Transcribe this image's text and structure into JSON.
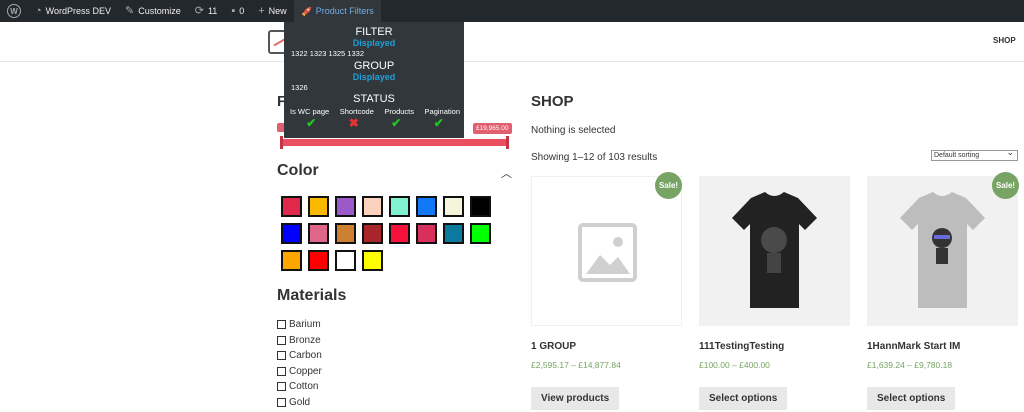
{
  "adminbar": {
    "site_name": "WordPress DEV",
    "customize": "Customize",
    "updates_count": "11",
    "comments_count": "0",
    "new_label": "New",
    "plugin_label": "Product Filters"
  },
  "header": {
    "nav_shop": "SHOP"
  },
  "debug": {
    "filter_heading": "FILTER",
    "filter_state": "Displayed",
    "filter_ids": "1322 1323 1325 1332",
    "group_heading": "GROUP",
    "group_state": "Displayed",
    "group_ids": "1326",
    "status_heading": "STATUS",
    "columns": [
      "Is WC page",
      "Shortcode",
      "Products",
      "Pagination"
    ],
    "statuses": [
      "ok",
      "fail",
      "ok",
      "ok"
    ]
  },
  "sidebar": {
    "filter_title": "F",
    "price_max_label": "£19,965.00",
    "color_title": "Color",
    "colors": [
      "#e0294a",
      "#fbb800",
      "#9b59c9",
      "#fcd1bd",
      "#7ff3cf",
      "#1278f6",
      "#f5f5dc",
      "#000000",
      "#0000ff",
      "#e0678a",
      "#cd7f32",
      "#a8262b",
      "#f7113c",
      "#d92f5c",
      "#0c7a9e",
      "#00ff00",
      "#ffa500",
      "#ff0000",
      "#ffffff",
      "#ffff00"
    ],
    "materials_title": "Materials",
    "materials": [
      "Barium",
      "Bronze",
      "Carbon",
      "Copper",
      "Cotton",
      "Gold"
    ]
  },
  "main": {
    "title": "SHOP",
    "nothing_selected": "Nothing is selected",
    "showing": "Showing 1–12 of 103 results",
    "sorting": "Default sorting",
    "sale_label": "Sale!",
    "products": [
      {
        "name": "1 GROUP",
        "price": "£2,595.17 – £14,877.84",
        "button": "View products",
        "image": "placeholder-icon",
        "sale": true
      },
      {
        "name": "111TestingTesting",
        "price": "£100.00 – £400.00",
        "button": "Select options",
        "image": "black-tshirt",
        "sale": false
      },
      {
        "name": "1HannMark Start IM",
        "price": "£1,639.24 – £9,780.18",
        "button": "Select options",
        "image": "grey-tshirt",
        "sale": true
      }
    ]
  }
}
